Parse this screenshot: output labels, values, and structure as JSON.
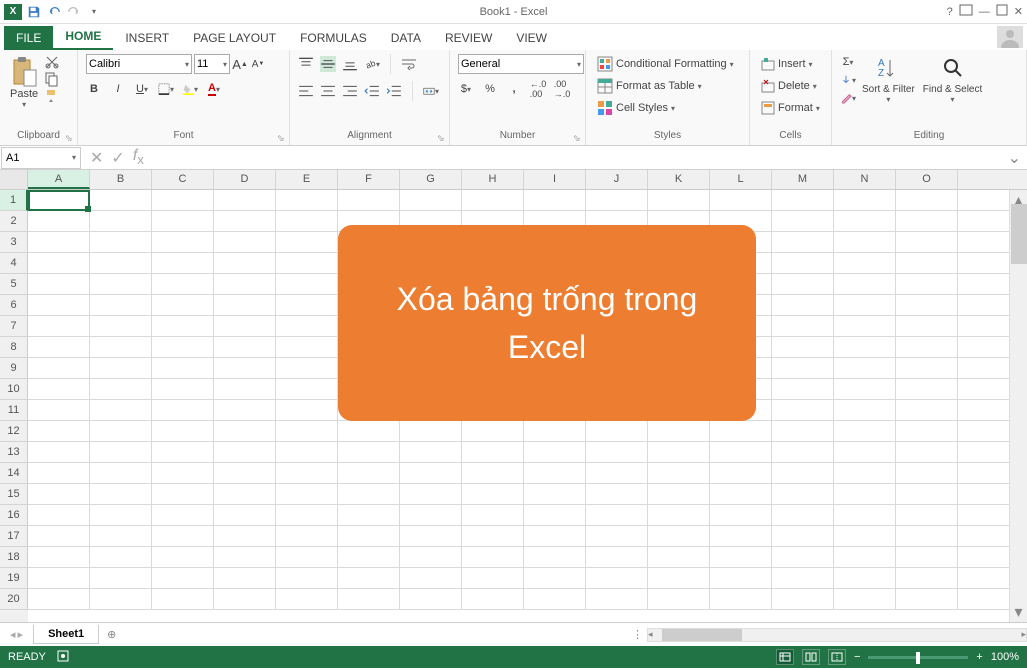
{
  "title": "Book1 - Excel",
  "tabs": {
    "file": "FILE",
    "home": "HOME",
    "insert": "INSERT",
    "page_layout": "PAGE LAYOUT",
    "formulas": "FORMULAS",
    "data": "DATA",
    "review": "REVIEW",
    "view": "VIEW"
  },
  "ribbon": {
    "clipboard": {
      "paste": "Paste",
      "label": "Clipboard"
    },
    "font": {
      "name": "Calibri",
      "size": "11",
      "label": "Font"
    },
    "alignment": {
      "label": "Alignment"
    },
    "number": {
      "format": "General",
      "label": "Number"
    },
    "styles": {
      "cond": "Conditional Formatting",
      "fmt_table": "Format as Table",
      "cell_styles": "Cell Styles",
      "label": "Styles"
    },
    "cells": {
      "insert": "Insert",
      "delete": "Delete",
      "format": "Format",
      "label": "Cells"
    },
    "editing": {
      "sort": "Sort & Filter",
      "find": "Find & Select",
      "label": "Editing"
    }
  },
  "namebox": "A1",
  "columns": [
    "A",
    "B",
    "C",
    "D",
    "E",
    "F",
    "G",
    "H",
    "I",
    "J",
    "K",
    "L",
    "M",
    "N",
    "O"
  ],
  "rows": [
    "1",
    "2",
    "3",
    "4",
    "5",
    "6",
    "7",
    "8",
    "9",
    "10",
    "11",
    "12",
    "13",
    "14",
    "15",
    "16",
    "17",
    "18",
    "19",
    "20"
  ],
  "overlay": "Xóa bảng trống trong Excel",
  "sheet": "Sheet1",
  "status": "READY",
  "zoom": "100%"
}
